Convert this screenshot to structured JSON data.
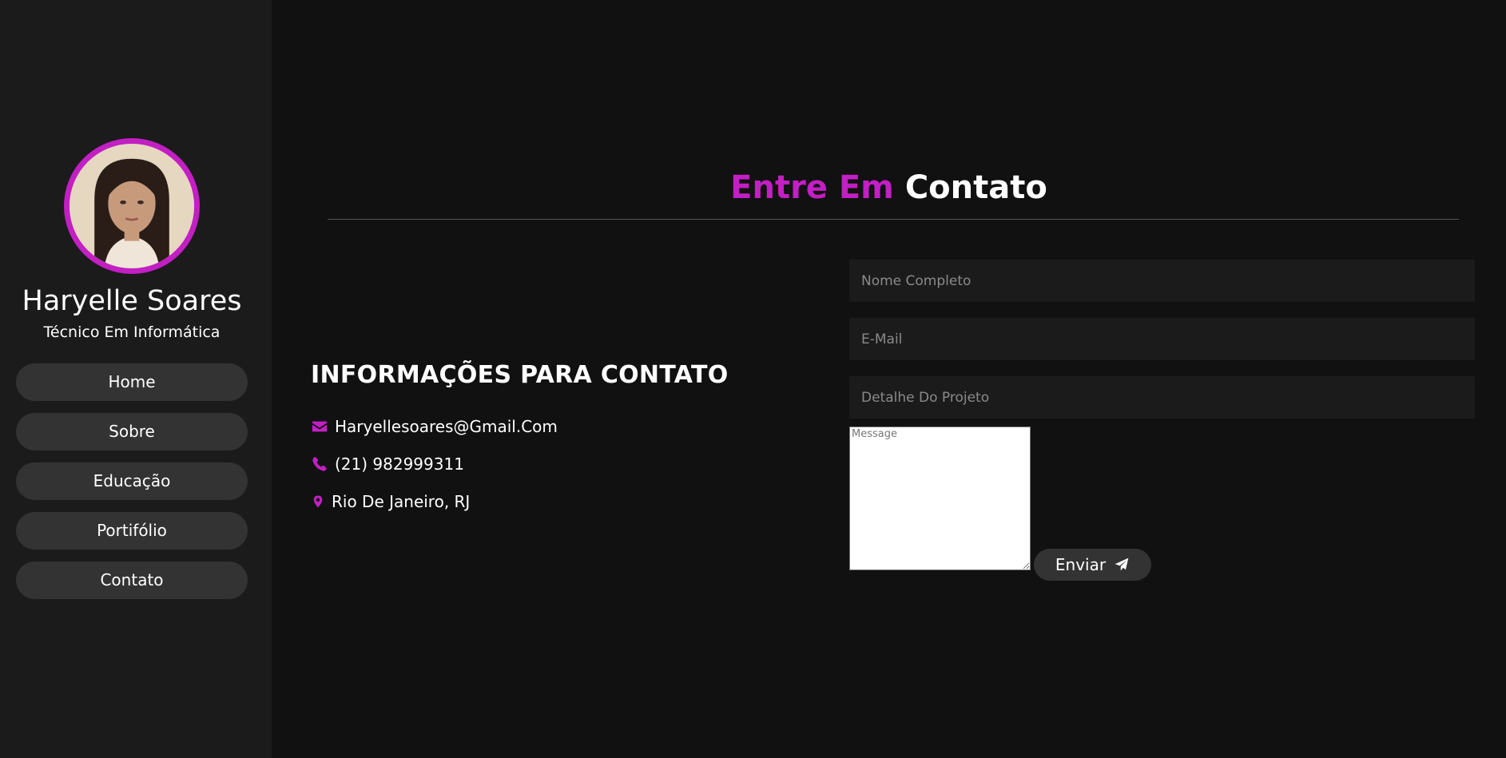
{
  "colors": {
    "accent": "#c21fc4",
    "background": "#111111",
    "sidebar_background": "#1b1b1b",
    "button_background": "#333333",
    "field_background": "#1b1b1b"
  },
  "sidebar": {
    "profile": {
      "name": "Haryelle Soares",
      "role": "Técnico Em Informática"
    },
    "nav": [
      {
        "label": "Home"
      },
      {
        "label": "Sobre"
      },
      {
        "label": "Educação"
      },
      {
        "label": "Portifólio"
      },
      {
        "label": "Contato"
      }
    ]
  },
  "main": {
    "title_accent": "Entre Em",
    "title_rest": "Contato",
    "info": {
      "heading": "INFORMAÇÕES PARA CONTATO",
      "email": "Haryellesoares@Gmail.Com",
      "phone": "(21) 982999311",
      "location": "Rio De Janeiro, RJ",
      "icons": [
        "envelope-icon",
        "phone-icon",
        "map-marker-icon"
      ]
    },
    "form": {
      "name_placeholder": "Nome Completo",
      "email_placeholder": "E-Mail",
      "project_placeholder": "Detalhe Do Projeto",
      "message_placeholder": "Message",
      "submit_label": "Enviar",
      "submit_icon": "paper-plane-icon"
    }
  }
}
